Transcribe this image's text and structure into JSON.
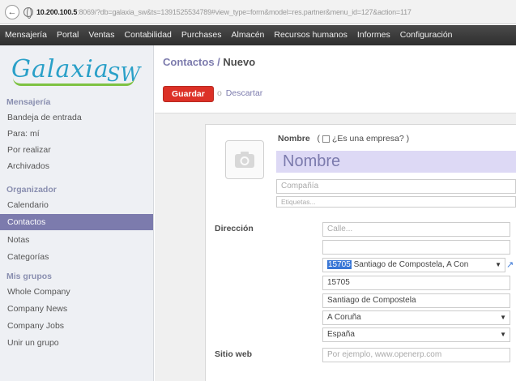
{
  "browser": {
    "url_host": "10.200.100.5",
    "url_rest": ":8069/?db=galaxia_sw&ts=1391525534789#view_type=form&model=res.partner&menu_id=127&action=117"
  },
  "topmenu": [
    "Mensajería",
    "Portal",
    "Ventas",
    "Contabilidad",
    "Purchases",
    "Almacén",
    "Recursos humanos",
    "Informes",
    "Configuración"
  ],
  "logo": {
    "main": "Galaxia",
    "sub": "SW"
  },
  "sidebar": {
    "sections": {
      "messaging": "Mensajería",
      "organizer": "Organizador",
      "groups": "Mis grupos"
    },
    "messaging_items": [
      "Bandeja de entrada",
      "Para: mí",
      "Por realizar",
      "Archivados"
    ],
    "organizer_items": [
      "Calendario",
      "Contactos",
      "Notas",
      "Categorías"
    ],
    "group_items": [
      "Whole Company",
      "Company News",
      "Company Jobs",
      "Unir un grupo"
    ],
    "active": "Contactos"
  },
  "breadcrumb": {
    "parent": "Contactos",
    "separator": " / ",
    "current": "Nuevo"
  },
  "actions": {
    "save": "Guardar",
    "or": "o",
    "discard": "Descartar"
  },
  "form": {
    "name_label": "Nombre",
    "is_company_label": "¿Es una empresa?",
    "name_placeholder": "Nombre",
    "company_placeholder": "Compañía",
    "tags_placeholder": "Etiquetas...",
    "address_label": "Dirección",
    "street_placeholder": "Calle...",
    "street2_value": "",
    "zip_city_zip": "15705",
    "zip_city_rest": " Santiago de Compostela, A Con",
    "zip_value": "15705",
    "city_value": "Santiago de Compostela",
    "state_value": "A Coruña",
    "country_value": "España",
    "website_label": "Sitio web",
    "website_placeholder": "Por ejemplo, www.openerp.com"
  }
}
